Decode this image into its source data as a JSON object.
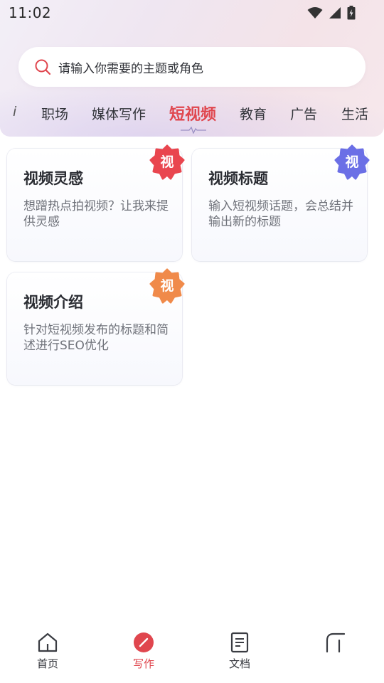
{
  "status_bar": {
    "time": "11:02",
    "icons": [
      "wifi-icon",
      "signal-icon",
      "battery-charging-icon"
    ]
  },
  "search": {
    "placeholder": "请输入你需要的主题或角色",
    "icon": "search-icon",
    "icon_color": "#e0464e"
  },
  "tabs": [
    {
      "label": "i",
      "active": false
    },
    {
      "label": "职场",
      "active": false
    },
    {
      "label": "媒体写作",
      "active": false
    },
    {
      "label": "短视频",
      "active": true
    },
    {
      "label": "教育",
      "active": false
    },
    {
      "label": "广告",
      "active": false
    },
    {
      "label": "生活",
      "active": false
    }
  ],
  "cards": [
    {
      "title": "视频灵感",
      "description": "想蹭热点拍视频？让我来提供灵感",
      "badge": "视",
      "badge_color": "#e9464f"
    },
    {
      "title": "视频标题",
      "description": "输入短视频话题，会总结并输出新的标题",
      "badge": "视",
      "badge_color": "#6b6fe6"
    },
    {
      "title": "视频介绍",
      "description": "针对短视频发布的标题和简述进行SEO优化",
      "badge": "视",
      "badge_color": "#f08a4a"
    }
  ],
  "bottom_nav": [
    {
      "label": "首页",
      "icon": "home-icon",
      "active": false
    },
    {
      "label": "写作",
      "icon": "pen-icon",
      "active": true
    },
    {
      "label": "文档",
      "icon": "document-icon",
      "active": false
    },
    {
      "label": "",
      "icon": "profile-icon",
      "active": false
    }
  ],
  "colors": {
    "accent": "#e0464e",
    "text_primary": "#2b2d33",
    "text_secondary": "#6f727a"
  }
}
